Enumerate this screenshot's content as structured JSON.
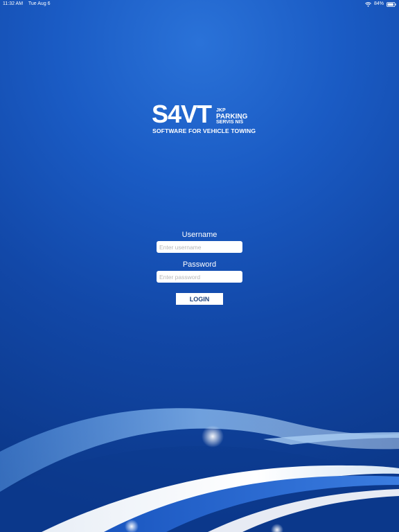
{
  "status_bar": {
    "time": "11:32 AM",
    "date": "Tue Aug 6",
    "battery": "84%"
  },
  "logo": {
    "main": "S4VT",
    "jkp": "JKP",
    "parking": "PARKING",
    "servis": "SERVIS NIŠ",
    "tagline": "SOFTWARE FOR VEHICLE TOWING"
  },
  "form": {
    "username_label": "Username",
    "username_placeholder": "Enter username",
    "username_value": "",
    "password_label": "Password",
    "password_placeholder": "Enter password",
    "password_value": "",
    "login_label": "LOGIN"
  },
  "icons": {
    "wifi": "wifi-icon",
    "battery": "battery-icon"
  },
  "colors": {
    "background": "#1a5bc4",
    "button_text": "#1a3f7a"
  }
}
